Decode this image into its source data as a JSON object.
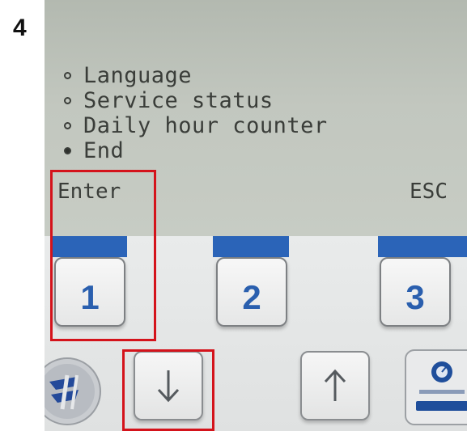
{
  "step_label": "4",
  "lcd": {
    "menu_items": [
      {
        "label": "Language",
        "selected": false
      },
      {
        "label": "Service status",
        "selected": false
      },
      {
        "label": "Daily hour counter",
        "selected": false
      },
      {
        "label": "End",
        "selected": true
      }
    ],
    "softkey_left": "Enter",
    "softkey_right": "ESC"
  },
  "keys": {
    "function_keys": [
      "1",
      "2",
      "3"
    ],
    "down_arrow": "down-arrow-icon",
    "up_arrow": "up-arrow-icon"
  },
  "colors": {
    "lcd_background": "#c2c7bf",
    "lcd_text": "#3a3d39",
    "key_blue": "#2b64b8",
    "key_number": "#2a5fae",
    "highlight": "#d4131b"
  }
}
